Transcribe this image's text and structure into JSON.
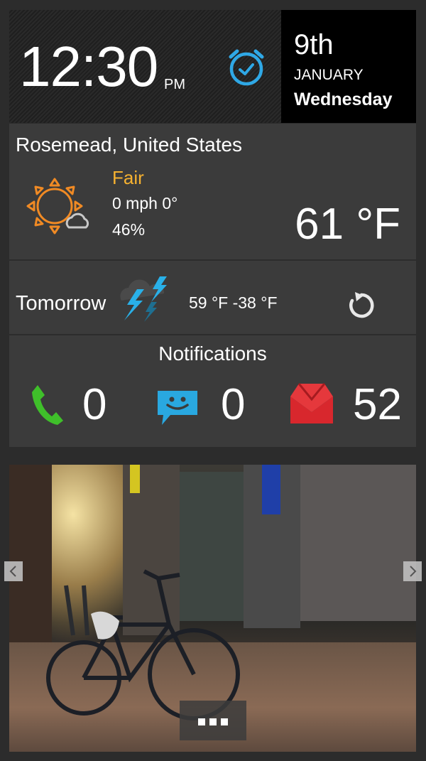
{
  "clock": {
    "time": "12:30",
    "ampm": "PM",
    "alarm_icon": "alarm-clock-icon"
  },
  "date": {
    "day": "9th",
    "month": "JANUARY",
    "weekday": "Wednesday"
  },
  "weather": {
    "location": "Rosemead, United States",
    "condition": "Fair",
    "wind": "0 mph 0°",
    "humidity": "46%",
    "temperature": "61 °F",
    "icon": "sun-cloud-icon",
    "accent": "#f5b130"
  },
  "forecast": {
    "label": "Tomorrow",
    "range": "59 °F -38 °F",
    "icon": "thunderstorm-icon",
    "refresh_icon": "refresh-icon"
  },
  "notifications": {
    "title": "Notifications",
    "calls": "0",
    "messages": "0",
    "mail": "52",
    "colors": {
      "call": "#3fbf2a",
      "message": "#29a8e0",
      "mail": "#d8272d"
    }
  },
  "gallery": {
    "prev_icon": "chevron-left-icon",
    "next_icon": "chevron-right-icon",
    "more_icon": "more-dots-icon"
  }
}
